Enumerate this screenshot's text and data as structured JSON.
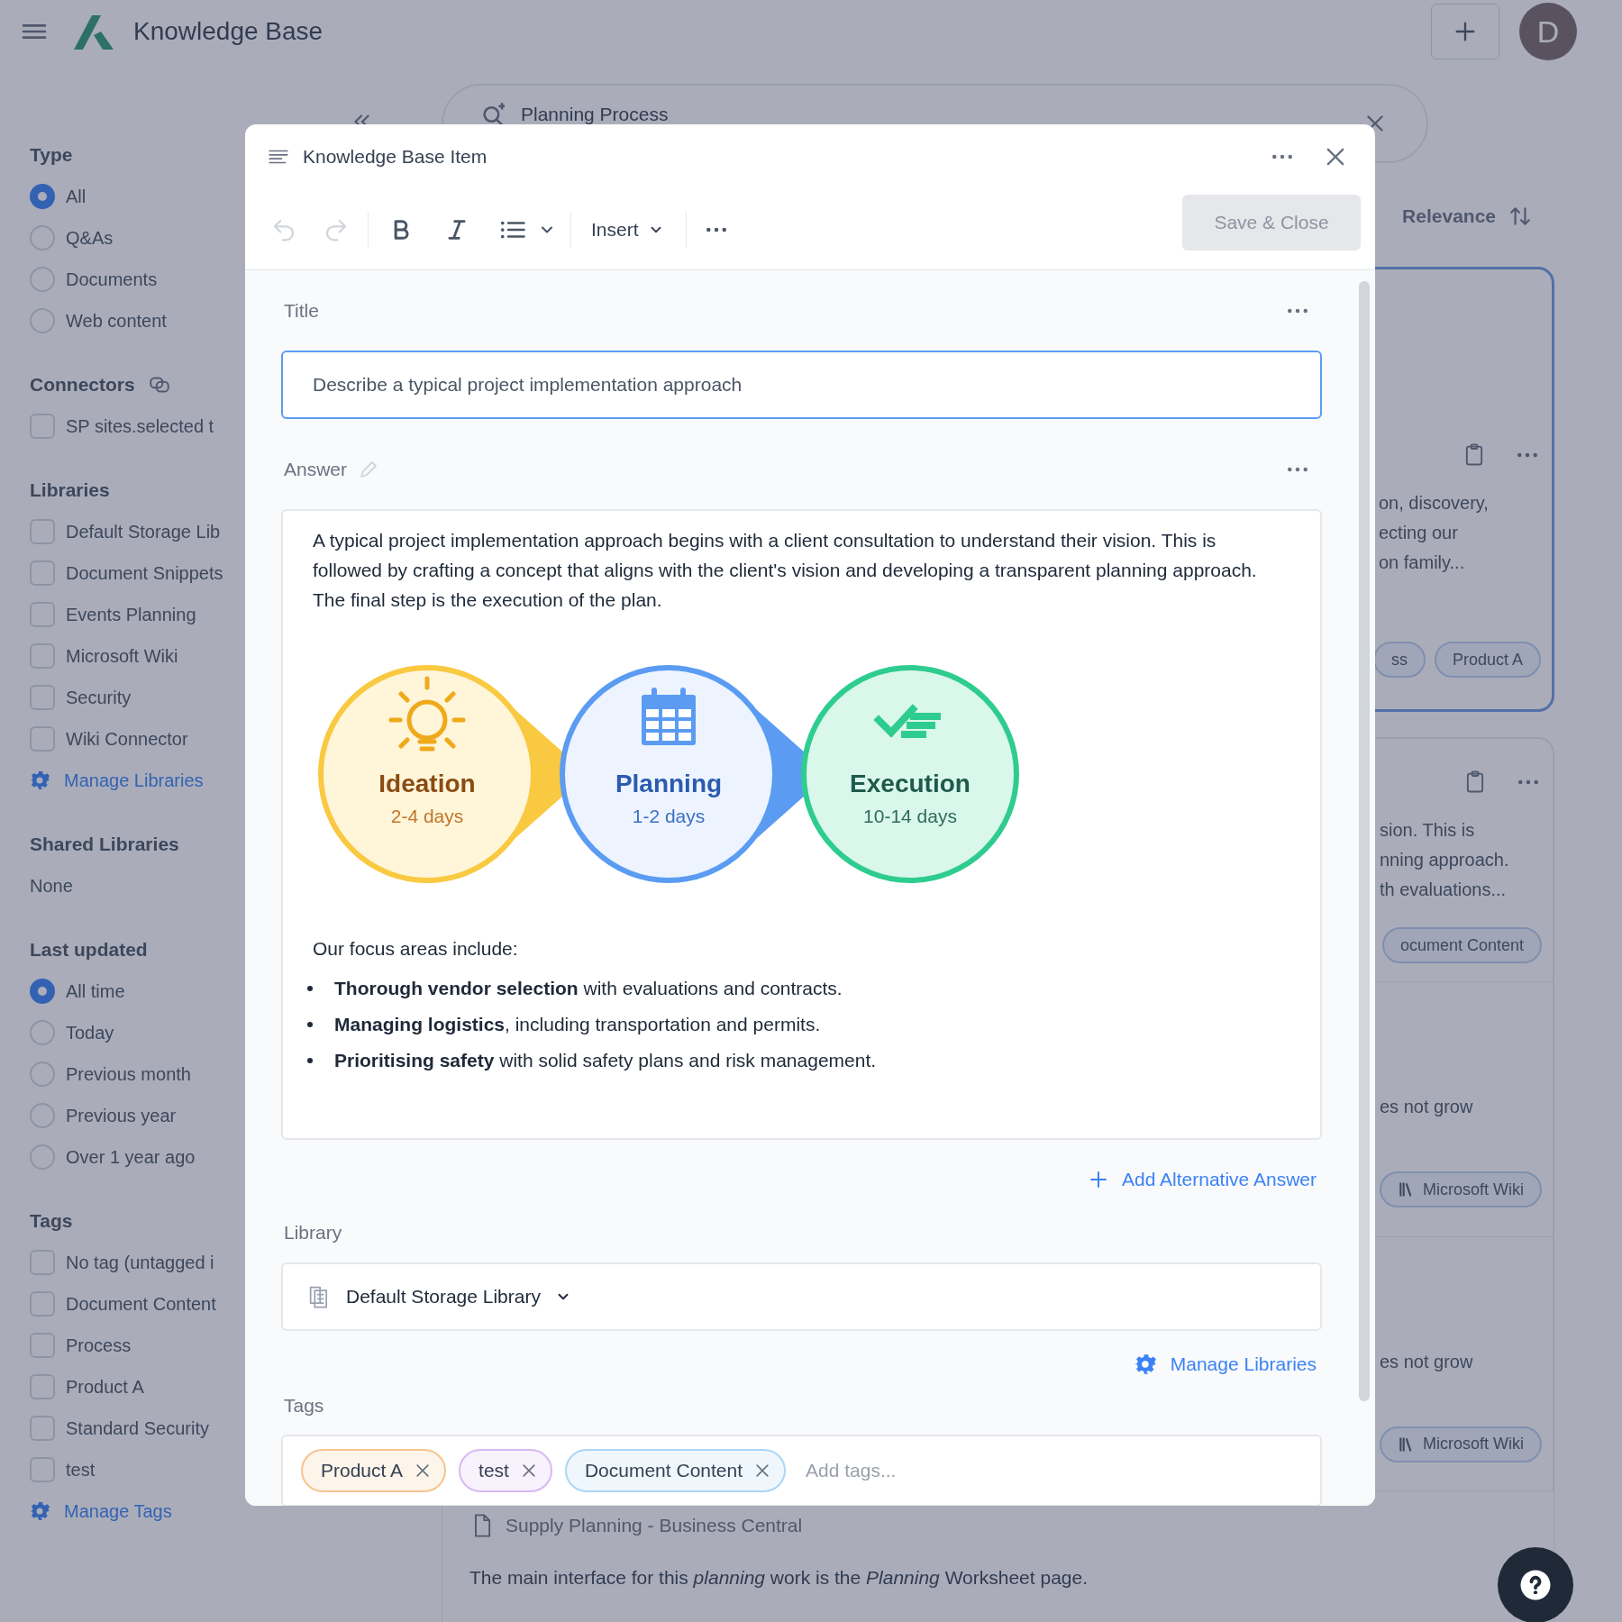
{
  "app": {
    "title": "Knowledge Base",
    "avatar": "D"
  },
  "search": {
    "value": "Planning Process"
  },
  "sort": {
    "label": "Relevance"
  },
  "filters": [
    {
      "title": "Type",
      "kind": "radio",
      "items": [
        {
          "label": "All",
          "selected": true
        },
        {
          "label": "Q&As",
          "selected": false
        },
        {
          "label": "Documents",
          "selected": false
        },
        {
          "label": "Web content",
          "selected": false
        }
      ]
    },
    {
      "title": "Connectors",
      "kind": "checkbox",
      "items": [
        {
          "label": "SP sites.selected t",
          "checked": false
        }
      ]
    },
    {
      "title": "Libraries",
      "kind": "checkbox",
      "items": [
        {
          "label": "Default Storage Lib",
          "checked": false
        },
        {
          "label": "Document Snippets",
          "checked": false
        },
        {
          "label": "Events Planning",
          "checked": false
        },
        {
          "label": "Microsoft Wiki",
          "checked": false
        },
        {
          "label": "Security",
          "checked": false
        },
        {
          "label": "Wiki Connector",
          "checked": false
        }
      ],
      "link": "Manage Libraries"
    },
    {
      "title": "Shared Libraries",
      "kind": "text",
      "items": [
        {
          "label": "None"
        }
      ]
    },
    {
      "title": "Last updated",
      "kind": "radio",
      "items": [
        {
          "label": "All time",
          "selected": true
        },
        {
          "label": "Today",
          "selected": false
        },
        {
          "label": "Previous month",
          "selected": false
        },
        {
          "label": "Previous year",
          "selected": false
        },
        {
          "label": "Over 1 year ago",
          "selected": false
        }
      ]
    },
    {
      "title": "Tags",
      "kind": "checkbox",
      "items": [
        {
          "label": "No tag (untagged i",
          "checked": false
        },
        {
          "label": "Document Content",
          "checked": false
        },
        {
          "label": "Process",
          "checked": false
        },
        {
          "label": "Product A",
          "checked": false
        },
        {
          "label": "Standard Security",
          "checked": false
        },
        {
          "label": "test",
          "checked": false
        }
      ],
      "link": "Manage Tags"
    }
  ],
  "results": [
    {
      "kind": "card",
      "selected": true,
      "lines": [
        "on, discovery,",
        "ecting our",
        "on family..."
      ],
      "tags": [
        {
          "label": "ss"
        },
        {
          "label": "Product A"
        }
      ]
    },
    {
      "kind": "card",
      "selected": false,
      "lines": [
        "sion. This is",
        "nning approach.",
        "th evaluations..."
      ],
      "tags": [
        {
          "label": "ocument Content"
        }
      ]
    },
    {
      "kind": "row",
      "lines": [
        "es not grow"
      ],
      "tags": [
        {
          "label": "Microsoft Wiki"
        }
      ]
    },
    {
      "kind": "row",
      "lines": [
        "es not grow"
      ],
      "tags": [
        {
          "label": "Microsoft Wiki"
        }
      ]
    },
    {
      "kind": "document",
      "title": "Supply Planning - Business Central",
      "lines": [
        "The main interface for this *planning* work is the *Planning* Worksheet page."
      ]
    }
  ],
  "modal": {
    "title": "Knowledge Base Item",
    "insert": "Insert",
    "save_button": {
      "label": "Save & Close",
      "disabled": true
    },
    "title_label": "Title",
    "title_value": "Describe a typical project implementation approach",
    "answer_label": "Answer",
    "answer_paragraph": "A typical project implementation approach begins with a client consultation to understand their vision. This is followed by crafting a concept that aligns with the client's vision and developing a transparent planning approach. The final step is the execution of the plan.",
    "stages": [
      {
        "title": "Ideation",
        "duration": "2-4 days",
        "color": "#f9c941"
      },
      {
        "title": "Planning",
        "duration": "1-2 days",
        "color": "#5b9cf2"
      },
      {
        "title": "Execution",
        "duration": "10-14 days",
        "color": "#2ecc8f"
      }
    ],
    "focus_intro": "Our focus areas include:",
    "bullets": [
      "**Thorough vendor selection** with evaluations and contracts.",
      "**Managing logistics**, including transportation and permits.",
      "**Prioritising safety** with solid safety plans and risk management."
    ],
    "add_alternative": "Add Alternative Answer",
    "library_label": "Library",
    "library_value": "Default Storage Library",
    "manage_libraries": "Manage Libraries",
    "tags_label": "Tags",
    "tags": [
      {
        "label": "Product A",
        "color": "#f6c48f"
      },
      {
        "label": "test",
        "color": "#d9b8f2"
      },
      {
        "label": "Document Content",
        "color": "#a9d6f5"
      }
    ],
    "tags_placeholder": "Add tags..."
  }
}
